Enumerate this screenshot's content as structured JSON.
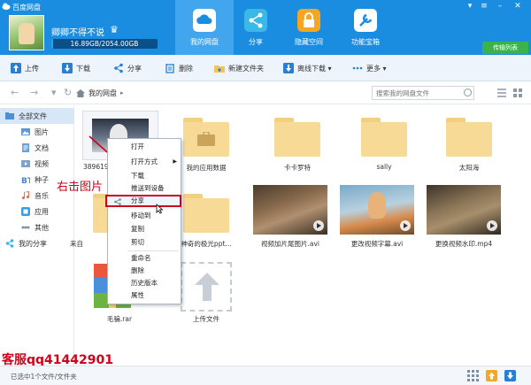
{
  "app": {
    "title": "百度网盘"
  },
  "user": {
    "name": "卿卿不得不说",
    "vip_badge": "♛",
    "quota_text": "16.89GB/2054.00GB",
    "quota_fraction": 0.0082
  },
  "nav_tabs": [
    {
      "label": "我的网盘",
      "icon": "cloud-icon",
      "active": true
    },
    {
      "label": "分享",
      "icon": "share-icon",
      "active": false
    },
    {
      "label": "隐藏空间",
      "icon": "lock-icon",
      "active": false
    },
    {
      "label": "功能宝箱",
      "icon": "tools-icon",
      "active": false
    }
  ],
  "upgrade_label": "传输列表",
  "toolbar": [
    {
      "label": "上传",
      "icon": "upload-icon"
    },
    {
      "label": "下载",
      "icon": "download-icon"
    },
    {
      "label": "分享",
      "icon": "share-icon"
    },
    {
      "label": "删除",
      "icon": "delete-icon"
    },
    {
      "label": "新建文件夹",
      "icon": "new-folder-icon"
    },
    {
      "label": "离线下载 ▾",
      "icon": "offline-download-icon"
    },
    {
      "label": "更多 ▾",
      "icon": "more-icon"
    }
  ],
  "breadcrumb": {
    "home": "我的网盘",
    "separator": "▸"
  },
  "search": {
    "placeholder": "搜索我的网盘文件"
  },
  "sidebar": [
    {
      "label": "全部文件",
      "icon": "all-files-icon",
      "active": true
    },
    {
      "label": "图片",
      "icon": "image-icon",
      "active": false
    },
    {
      "label": "文档",
      "icon": "document-icon",
      "active": false
    },
    {
      "label": "视频",
      "icon": "video-icon",
      "active": false
    },
    {
      "label": "种子",
      "icon": "torrent-icon",
      "active": false
    },
    {
      "label": "音乐",
      "icon": "music-icon",
      "active": false
    },
    {
      "label": "应用",
      "icon": "app-icon",
      "active": false
    },
    {
      "label": "其他",
      "icon": "other-icon",
      "active": false
    },
    {
      "label": "我的分享",
      "icon": "my-share-icon",
      "active": false
    }
  ],
  "files": [
    {
      "name": "389619",
      "kind": "image"
    },
    {
      "name": "我的应用数据",
      "kind": "folder"
    },
    {
      "name": "卡卡罗特",
      "kind": "folder"
    },
    {
      "name": "sally",
      "kind": "folder"
    },
    {
      "name": "太阳海",
      "kind": "folder"
    },
    {
      "name": "来自",
      "kind": "folder"
    },
    {
      "name": "神奇的极光ppt...",
      "kind": "folder"
    },
    {
      "name": "视频加片尾图片.avi",
      "kind": "video"
    },
    {
      "name": "更改视频字幕.avi",
      "kind": "video"
    },
    {
      "name": "更换视频水印.mp4",
      "kind": "video"
    },
    {
      "name": "毛骗.rar",
      "kind": "archive"
    },
    {
      "name": "上传文件",
      "kind": "upload"
    }
  ],
  "context_menu": [
    {
      "label": "打开",
      "submenu": false
    },
    {
      "label": "打开方式",
      "submenu": true
    },
    {
      "label": "下载",
      "submenu": false
    },
    {
      "label": "推送到设备",
      "submenu": false
    },
    {
      "label": "分享",
      "submenu": false,
      "highlight": true
    },
    {
      "label": "移动到",
      "submenu": false
    },
    {
      "label": "复制",
      "submenu": false
    },
    {
      "label": "剪切",
      "submenu": false
    },
    {
      "label": "重命名",
      "submenu": false
    },
    {
      "label": "删除",
      "submenu": false
    },
    {
      "label": "历史版本",
      "submenu": false
    },
    {
      "label": "属性",
      "submenu": false
    }
  ],
  "annotations": {
    "right_click": "右击图片",
    "contact": "客服qq41442901"
  },
  "status": {
    "text": "已选中1个文件/文件夹"
  },
  "colors": {
    "header": "#1b8de0",
    "active_tab": "#42a6ee",
    "annotation": "#d0021b",
    "folder": "#f7da96"
  }
}
